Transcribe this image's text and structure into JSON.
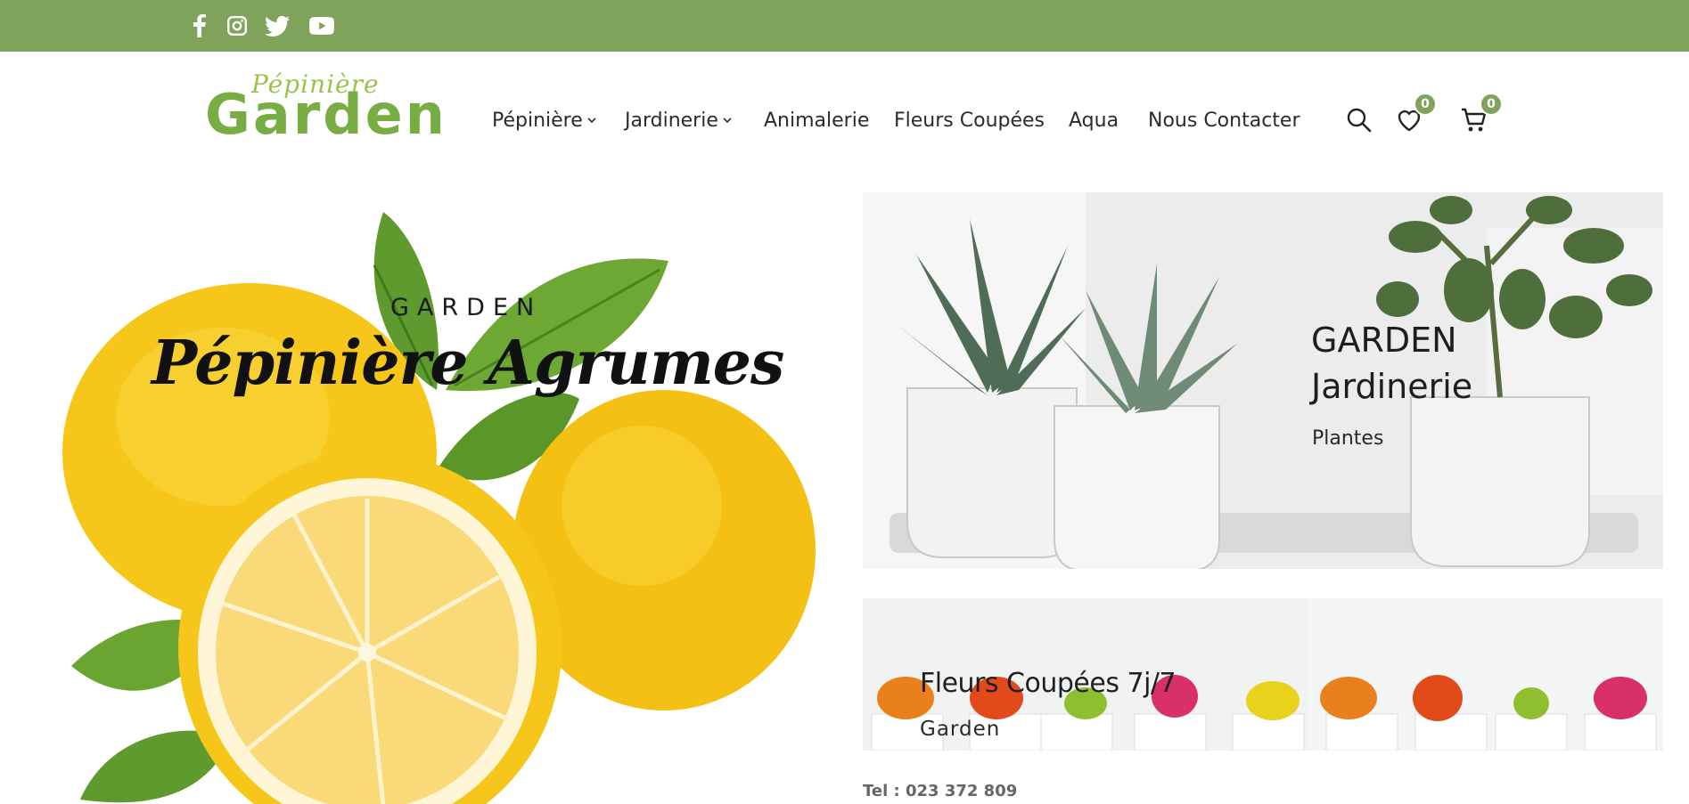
{
  "social": [
    {
      "icon": "facebook-icon"
    },
    {
      "icon": "instagram-icon"
    },
    {
      "icon": "twitter-icon"
    },
    {
      "icon": "youtube-icon"
    }
  ],
  "logo": {
    "top": "Pépinière",
    "main": "Garden"
  },
  "nav": [
    {
      "label": "Pépinière",
      "dropdown": true
    },
    {
      "label": "Jardinerie",
      "dropdown": true
    },
    {
      "label": "Animalerie",
      "dropdown": false
    },
    {
      "label": "Fleurs Coupées",
      "dropdown": false
    },
    {
      "label": "Aqua",
      "dropdown": false
    },
    {
      "label": "Nous Contacter",
      "dropdown": false
    }
  ],
  "header_icons": {
    "search": "search-icon",
    "wishlist": {
      "icon": "heart-icon",
      "count": "0"
    },
    "cart": {
      "icon": "cart-icon",
      "count": "0"
    }
  },
  "hero": {
    "subtitle": "GARDEN",
    "title": "Pépinière Agrumes"
  },
  "banner1": {
    "title_line1": "GARDEN",
    "title_line2": "Jardinerie",
    "subtitle": "Plantes"
  },
  "banner2": {
    "title": "Fleurs Coupées 7j/7",
    "subtitle": "Garden"
  },
  "contact": {
    "tel": "Tel : 023 372 809"
  },
  "colors": {
    "accent": "#80a35c",
    "logo_green": "#77ad42",
    "lemon": "#f4c51a",
    "leaf": "#5e9a2e"
  }
}
